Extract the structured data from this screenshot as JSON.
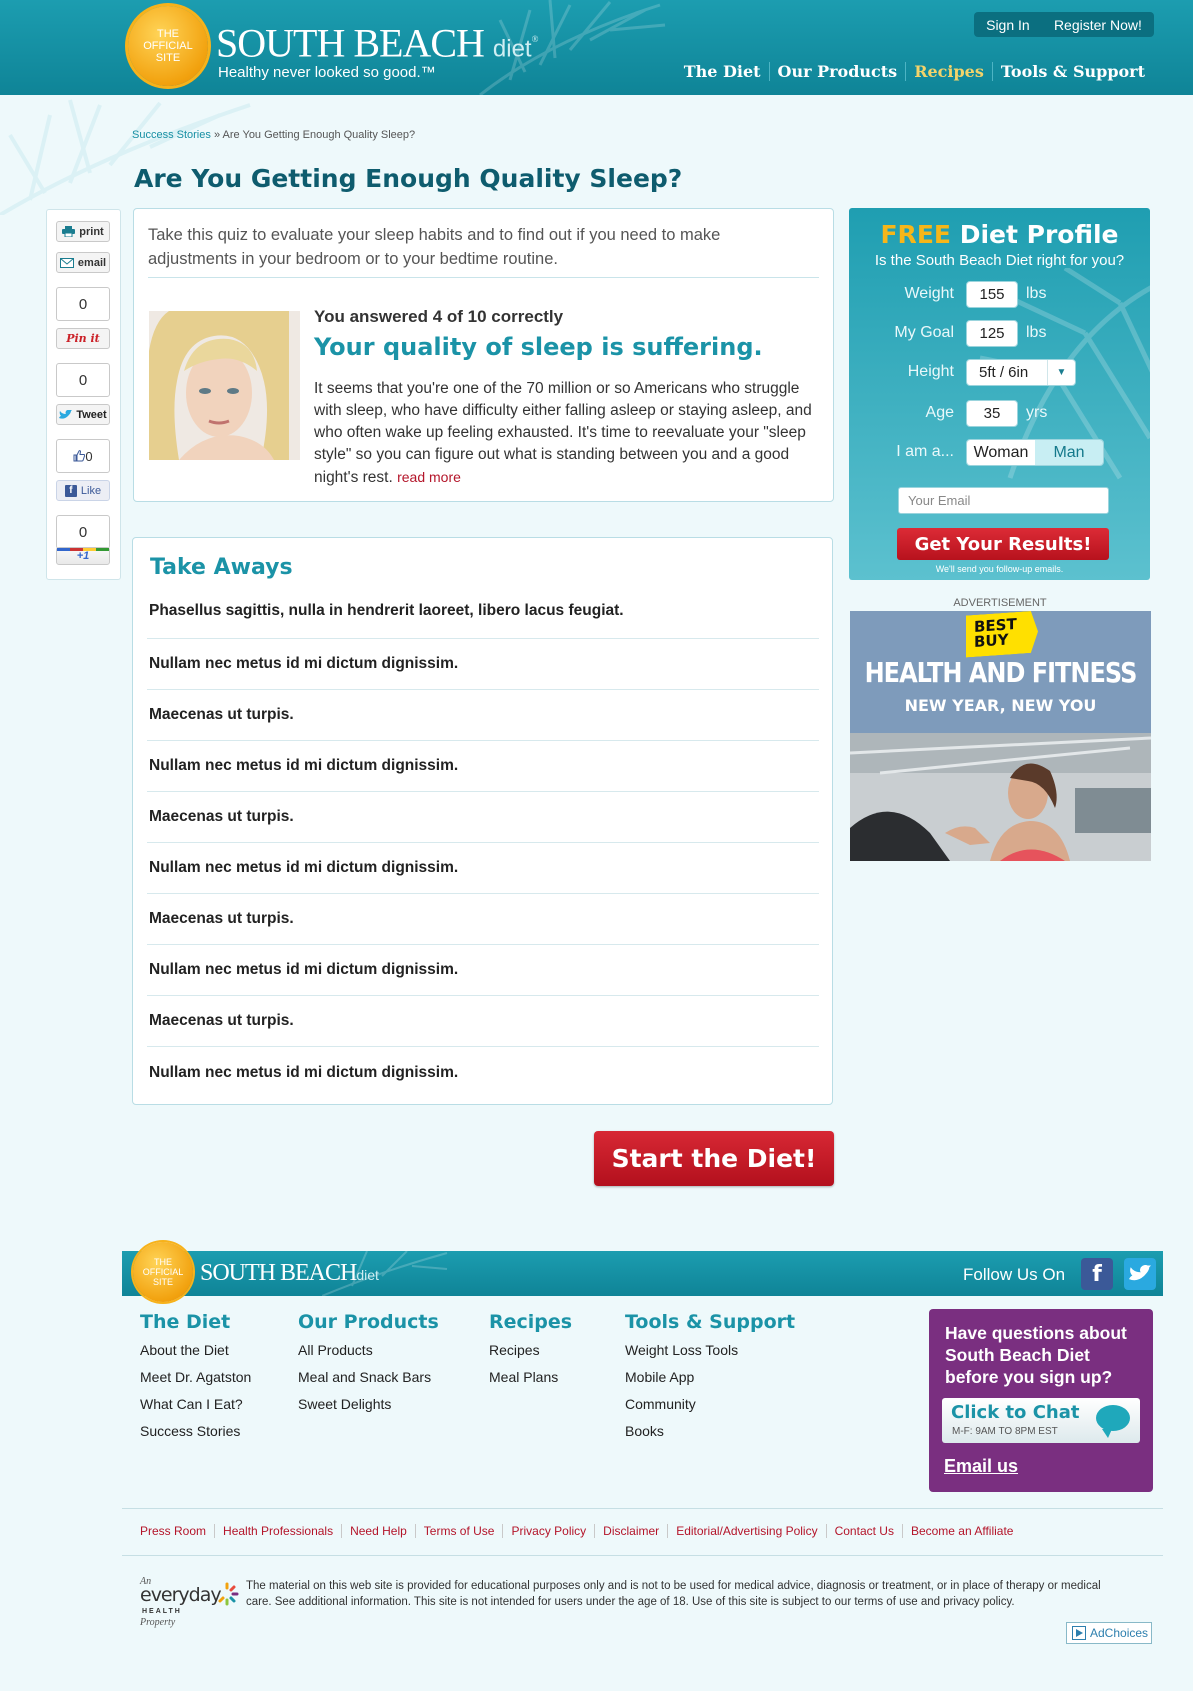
{
  "header": {
    "seal_lines": [
      "The",
      "Official",
      "Site"
    ],
    "brand": "SOUTH BEACH",
    "brand_suffix": "diet",
    "brand_mark": "®",
    "tagline": "Healthy never looked so good.™",
    "sign_in": "Sign In",
    "register": "Register Now!",
    "nav": [
      "The Diet",
      "Our Products",
      "Recipes",
      "Tools & Support"
    ],
    "active_nav": "Recipes"
  },
  "breadcrumb": {
    "parent": "Success Stories",
    "separator": "»",
    "current": "Are You Getting Enough Quality Sleep?"
  },
  "page_title": "Are You Getting Enough Quality Sleep?",
  "share": {
    "print": "print",
    "email": "email",
    "pin_count": "0",
    "pin_label": "Pin it",
    "tweet_count": "0",
    "tweet_label": "Tweet",
    "like_count": "0",
    "like_label": "Like",
    "plus_count": "0",
    "plus_label": "+1"
  },
  "result": {
    "intro": "Take this quiz to evaluate your sleep habits and to find out if you need to make adjustments in your bedroom or to your bedtime routine.",
    "score": "You answered 4 of 10 correctly",
    "verdict": "Your quality of sleep is suffering.",
    "description": "It seems that you're one of the 70 million or so Americans who struggle with sleep, who have difficulty either falling asleep or staying asleep, and who often wake up feeling exhausted. It's time to reevaluate your \"sleep style\" so you can figure out what is standing between you and a good night's rest.",
    "read_more": "read more"
  },
  "takeaways": {
    "title": "Take Aways",
    "items": [
      "Phasellus sagittis, nulla in hendrerit laoreet, libero lacus feugiat.",
      "Nullam nec metus id mi dictum dignissim.",
      "Maecenas ut turpis.",
      "Nullam nec metus id mi dictum dignissim.",
      "Maecenas ut turpis.",
      "Nullam nec metus id mi dictum dignissim.",
      "Maecenas ut turpis.",
      "Nullam nec metus id mi dictum dignissim.",
      "Maecenas ut turpis.",
      "Nullam nec metus id mi dictum dignissim."
    ]
  },
  "start_button": "Start the Diet!",
  "profile": {
    "title_free": "FREE",
    "title_rest": "Diet Profile",
    "subtitle": "Is the South Beach Diet right for you?",
    "weight_label": "Weight",
    "weight_value": "155",
    "weight_unit": "lbs",
    "goal_label": "My Goal",
    "goal_value": "125",
    "goal_unit": "lbs",
    "height_label": "Height",
    "height_value": "5ft / 6in",
    "age_label": "Age",
    "age_value": "35",
    "age_unit": "yrs",
    "gender_label": "I am a...",
    "gender_woman": "Woman",
    "gender_man": "Man",
    "email_placeholder": "Your Email",
    "submit": "Get Your Results!",
    "note": "We'll send you follow-up emails."
  },
  "ad": {
    "label": "ADVERTISEMENT",
    "brand": "BEST BUY",
    "headline": "HEALTH AND FITNESS",
    "subhead": "NEW YEAR, NEW YOU"
  },
  "footer": {
    "seal_lines": [
      "The",
      "Official",
      "Site"
    ],
    "brand": "SOUTH BEACH",
    "brand_suffix": "diet",
    "follow": "Follow Us On",
    "columns": [
      {
        "title": "The Diet",
        "links": [
          "About the Diet",
          "Meet Dr. Agatston",
          "What Can I Eat?",
          "Success Stories"
        ]
      },
      {
        "title": "Our Products",
        "links": [
          "All Products",
          "Meal and Snack Bars",
          "Sweet Delights"
        ]
      },
      {
        "title": "Recipes",
        "links": [
          "Recipes",
          "Meal Plans"
        ]
      },
      {
        "title": "Tools & Support",
        "links": [
          "Weight Loss Tools",
          "Mobile App",
          "Community",
          "Books"
        ]
      }
    ],
    "chat": {
      "question": "Have questions about South Beach Diet before you sign up?",
      "button": "Click to Chat",
      "hours": "M-F: 9AM TO 8PM EST",
      "email": "Email us"
    },
    "legal_links": [
      "Press Room",
      "Health Professionals",
      "Need Help",
      "Terms of Use",
      "Privacy Policy",
      "Disclaimer",
      "Editorial/Advertising Policy",
      "Contact Us",
      "Become an Affiliate"
    ],
    "eh_an": "An",
    "eh_name": "everyday",
    "eh_health": "HEALTH",
    "eh_property": "Property",
    "disclaimer": "The material on this web site is provided for educational purposes only and is not to be used for medical advice, diagnosis or treatment, or in place of therapy or medical care. See additional information. This site is not intended for users under the age of 18. Use of this site is subject to our terms of use and privacy policy.",
    "adchoices": "AdChoices"
  }
}
